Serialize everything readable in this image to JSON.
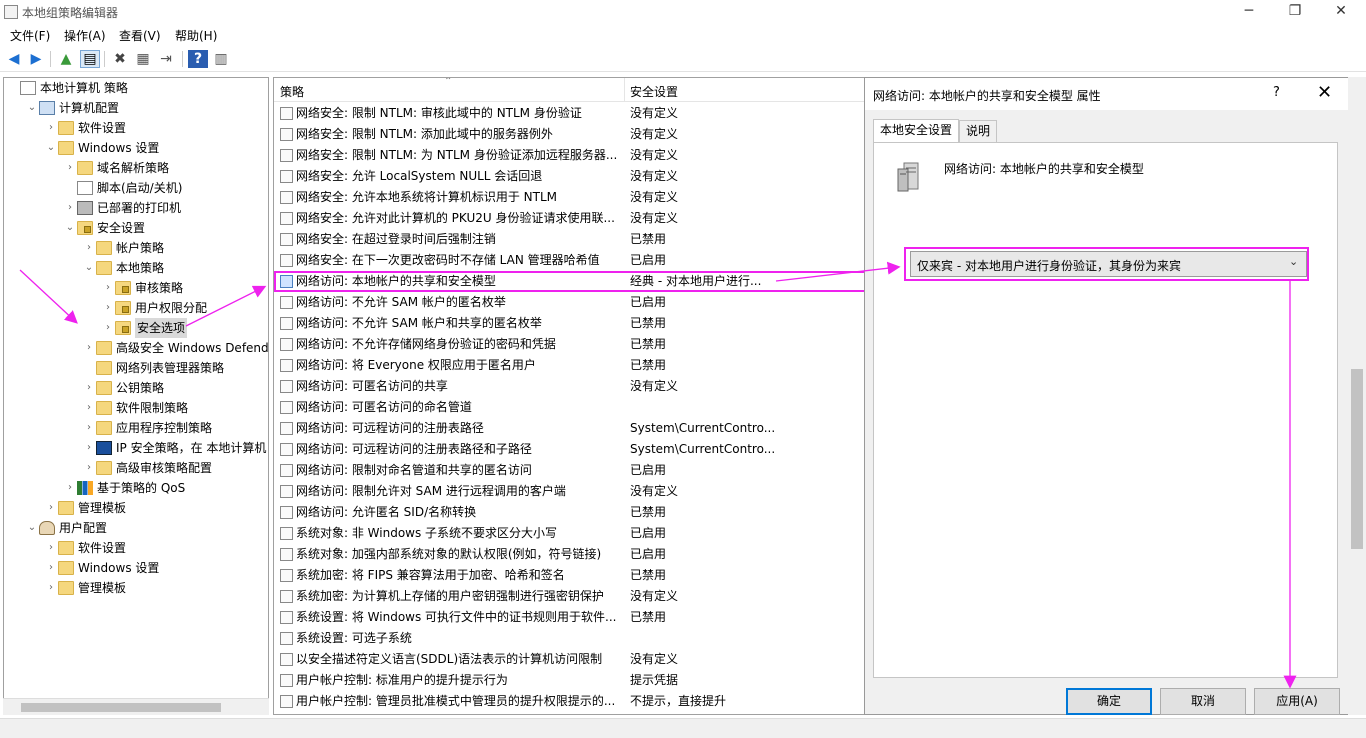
{
  "window": {
    "title": "本地组策略编辑器"
  },
  "menu": [
    "文件(F)",
    "操作(A)",
    "查看(V)",
    "帮助(H)"
  ],
  "tree": [
    {
      "label": "本地计算机 策略",
      "icon": "policy-doc-icon",
      "chev": ""
    },
    {
      "label": "计算机配置",
      "icon": "computer-icon",
      "chev": "v"
    },
    {
      "label": "软件设置",
      "icon": "folder-icon",
      "chev": ">"
    },
    {
      "label": "Windows 设置",
      "icon": "folder-icon",
      "chev": "v"
    },
    {
      "label": "域名解析策略",
      "icon": "folder-icon",
      "chev": ">"
    },
    {
      "label": "脚本(启动/关机)",
      "icon": "script-icon",
      "chev": ""
    },
    {
      "label": "已部署的打印机",
      "icon": "printer-icon",
      "chev": ">"
    },
    {
      "label": "安全设置",
      "icon": "security-folder-icon",
      "chev": "v"
    },
    {
      "label": "帐户策略",
      "icon": "folder-icon",
      "chev": ">"
    },
    {
      "label": "本地策略",
      "icon": "folder-icon",
      "chev": "v"
    },
    {
      "label": "审核策略",
      "icon": "lock-folder-icon",
      "chev": ">"
    },
    {
      "label": "用户权限分配",
      "icon": "lock-folder-icon",
      "chev": ">"
    },
    {
      "label": "安全选项",
      "icon": "lock-folder-icon",
      "chev": ">"
    },
    {
      "label": "高级安全 Windows Defender",
      "icon": "folder-icon",
      "chev": ">"
    },
    {
      "label": "网络列表管理器策略",
      "icon": "folder-icon",
      "chev": ""
    },
    {
      "label": "公钥策略",
      "icon": "folder-icon",
      "chev": ">"
    },
    {
      "label": "软件限制策略",
      "icon": "folder-icon",
      "chev": ">"
    },
    {
      "label": "应用程序控制策略",
      "icon": "folder-icon",
      "chev": ">"
    },
    {
      "label": "IP 安全策略，在 本地计算机",
      "icon": "ip-security-icon",
      "chev": ">"
    },
    {
      "label": "高级审核策略配置",
      "icon": "folder-icon",
      "chev": ">"
    },
    {
      "label": "基于策略的 QoS",
      "icon": "chart-icon",
      "chev": ">"
    },
    {
      "label": "管理模板",
      "icon": "folder-icon",
      "chev": ">"
    },
    {
      "label": "用户配置",
      "icon": "user-icon",
      "chev": "v"
    },
    {
      "label": "软件设置",
      "icon": "folder-icon",
      "chev": ">"
    },
    {
      "label": "Windows 设置",
      "icon": "folder-icon",
      "chev": ">"
    },
    {
      "label": "管理模板",
      "icon": "folder-icon",
      "chev": ">"
    }
  ],
  "list": {
    "col_policy": "策略",
    "col_setting": "安全设置",
    "rows": [
      {
        "name": "网络安全: 限制 NTLM: 审核此域中的 NTLM 身份验证",
        "value": "没有定义"
      },
      {
        "name": "网络安全: 限制 NTLM: 添加此域中的服务器例外",
        "value": "没有定义"
      },
      {
        "name": "网络安全: 限制 NTLM: 为 NTLM 身份验证添加远程服务器...",
        "value": "没有定义"
      },
      {
        "name": "网络安全: 允许 LocalSystem NULL 会话回退",
        "value": "没有定义"
      },
      {
        "name": "网络安全: 允许本地系统将计算机标识用于 NTLM",
        "value": "没有定义"
      },
      {
        "name": "网络安全: 允许对此计算机的 PKU2U 身份验证请求使用联...",
        "value": "没有定义"
      },
      {
        "name": "网络安全: 在超过登录时间后强制注销",
        "value": "已禁用"
      },
      {
        "name": "网络安全: 在下一次更改密码时不存储 LAN 管理器哈希值",
        "value": "已启用"
      },
      {
        "name": "网络访问: 本地帐户的共享和安全模型",
        "value": "经典 - 对本地用户进行..."
      },
      {
        "name": "网络访问: 不允许 SAM 帐户的匿名枚举",
        "value": "已启用"
      },
      {
        "name": "网络访问: 不允许 SAM 帐户和共享的匿名枚举",
        "value": "已禁用"
      },
      {
        "name": "网络访问: 不允许存储网络身份验证的密码和凭据",
        "value": "已禁用"
      },
      {
        "name": "网络访问: 将 Everyone 权限应用于匿名用户",
        "value": "已禁用"
      },
      {
        "name": "网络访问: 可匿名访问的共享",
        "value": "没有定义"
      },
      {
        "name": "网络访问: 可匿名访问的命名管道",
        "value": ""
      },
      {
        "name": "网络访问: 可远程访问的注册表路径",
        "value": "System\\CurrentContro..."
      },
      {
        "name": "网络访问: 可远程访问的注册表路径和子路径",
        "value": "System\\CurrentContro..."
      },
      {
        "name": "网络访问: 限制对命名管道和共享的匿名访问",
        "value": "已启用"
      },
      {
        "name": "网络访问: 限制允许对 SAM 进行远程调用的客户端",
        "value": "没有定义"
      },
      {
        "name": "网络访问: 允许匿名 SID/名称转换",
        "value": "已禁用"
      },
      {
        "name": "系统对象: 非 Windows 子系统不要求区分大小写",
        "value": "已启用"
      },
      {
        "name": "系统对象: 加强内部系统对象的默认权限(例如，符号链接)",
        "value": "已启用"
      },
      {
        "name": "系统加密: 将 FIPS 兼容算法用于加密、哈希和签名",
        "value": "已禁用"
      },
      {
        "name": "系统加密: 为计算机上存储的用户密钥强制进行强密钥保护",
        "value": "没有定义"
      },
      {
        "name": "系统设置: 将 Windows 可执行文件中的证书规则用于软件...",
        "value": "已禁用"
      },
      {
        "name": "系统设置: 可选子系统",
        "value": ""
      },
      {
        "name": "以安全描述符定义语言(SDDL)语法表示的计算机访问限制",
        "value": "没有定义"
      },
      {
        "name": "用户帐户控制: 标准用户的提升提示行为",
        "value": "提示凭据"
      },
      {
        "name": "用户帐户控制: 管理员批准模式中管理员的提升权限提示的...",
        "value": "不提示，直接提升"
      }
    ]
  },
  "dialog": {
    "title": "网络访问: 本地帐户的共享和安全模型 属性",
    "help": "?",
    "close": "✕",
    "tabs": [
      "本地安全设置",
      "说明"
    ],
    "policy_name": "网络访问: 本地帐户的共享和安全模型",
    "combo_value": "仅来宾 - 对本地用户进行身份验证，其身份为来宾",
    "ok": "确定",
    "cancel": "取消",
    "apply": "应用(A)"
  },
  "accent_color": "#ee22ee"
}
